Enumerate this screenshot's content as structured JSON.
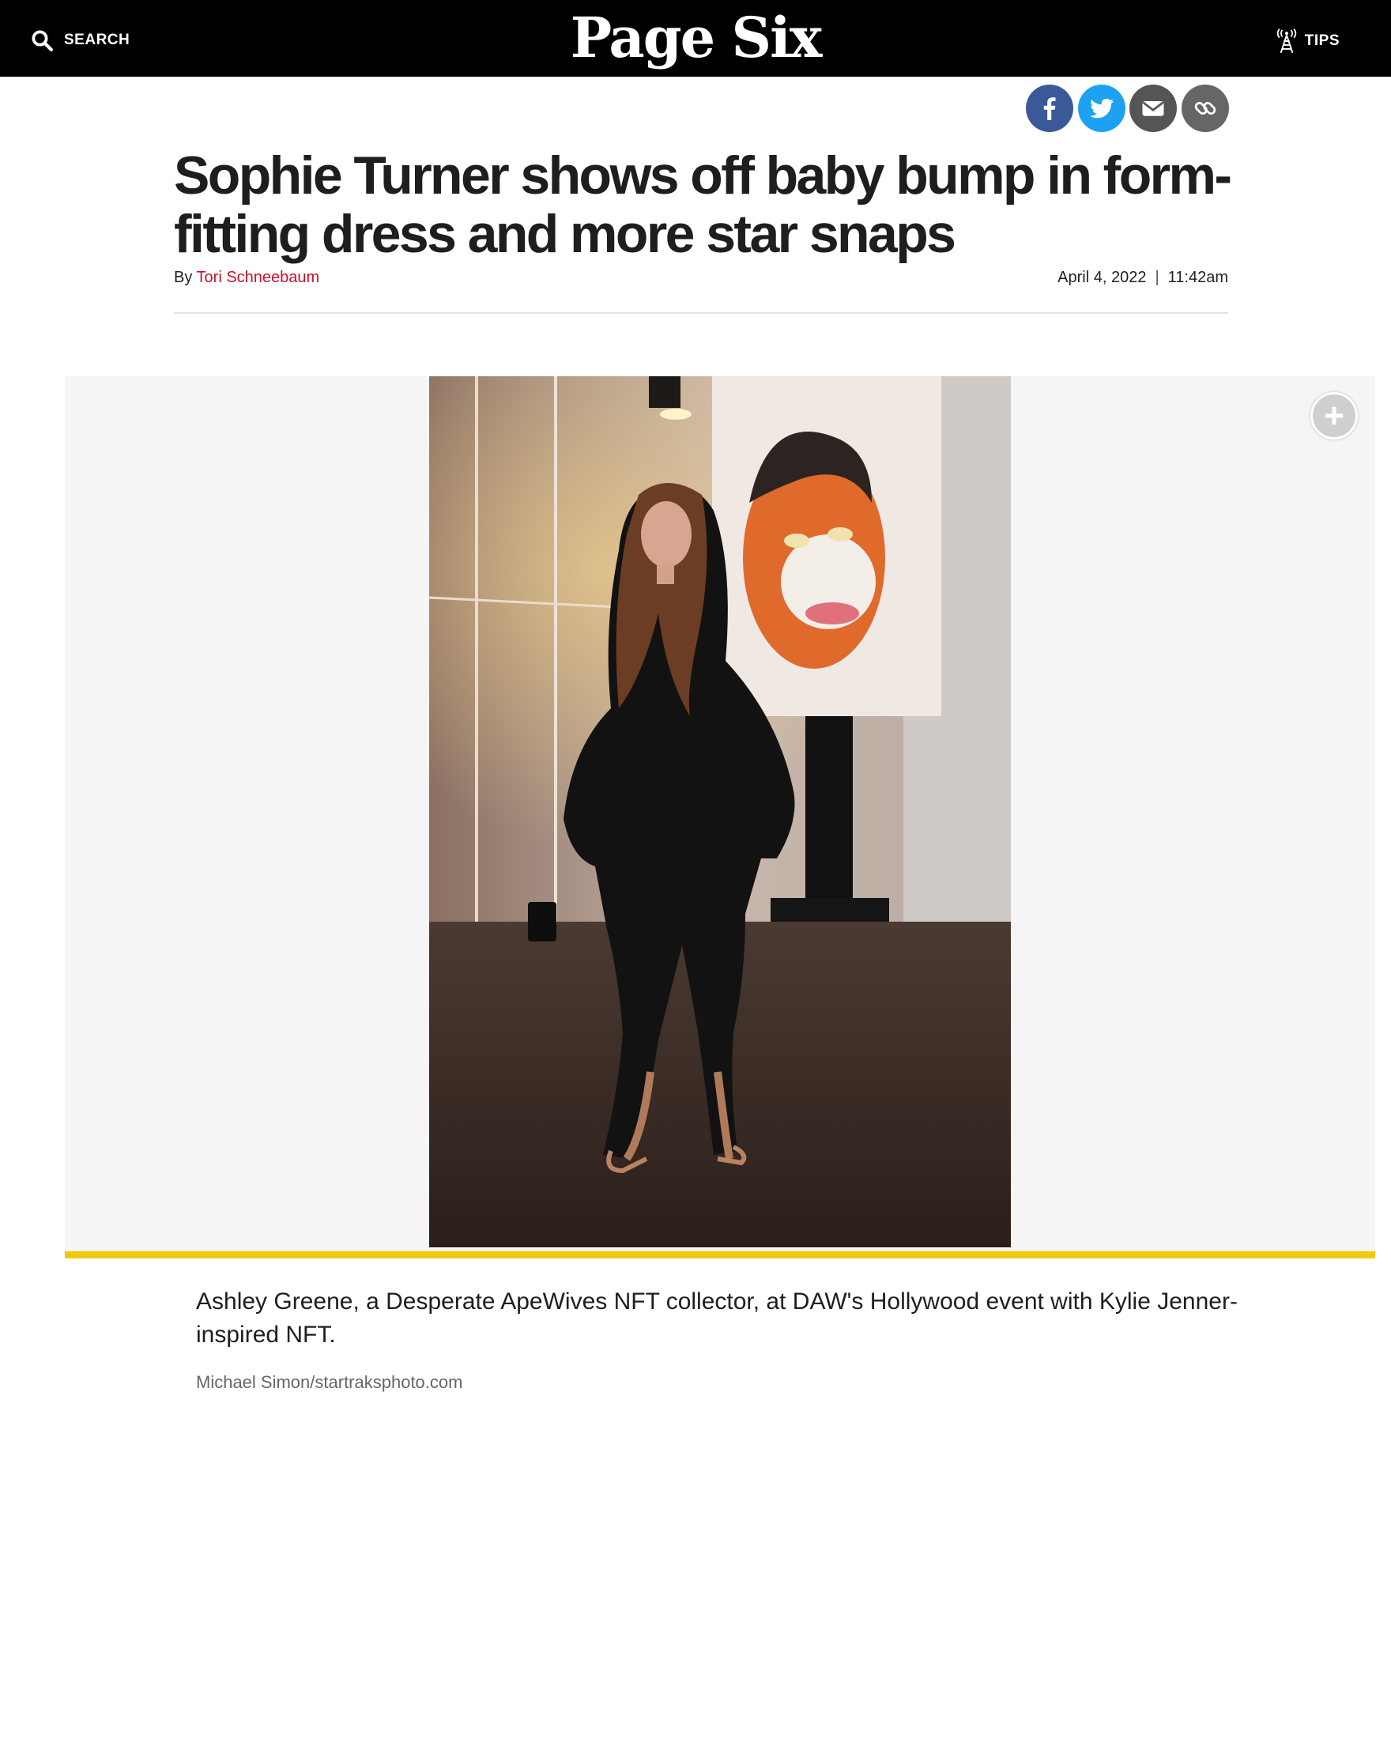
{
  "header": {
    "search_label": "SEARCH",
    "logo": "Page Six",
    "tips_label": "TIPS"
  },
  "share": {
    "icons": [
      "facebook-icon",
      "twitter-icon",
      "email-icon",
      "link-icon"
    ]
  },
  "article": {
    "headline": "Sophie Turner shows off baby bump in form-fitting dress and more star snaps",
    "by": "By",
    "author": "Tori Schneebaum",
    "date": "April 4, 2022",
    "date_separator": "|",
    "time": "11:42am"
  },
  "gallery": {
    "caption": "Ashley Greene, a Desperate ApeWives NFT collector, at DAW's Hollywood event with Kylie Jenner-inspired NFT.",
    "credit": "Michael Simon/startraksphoto.com",
    "expand_icon": "plus-icon"
  },
  "colors": {
    "header_bg": "#000000",
    "author_link": "#c8102e",
    "accent_bar": "#f2c811",
    "facebook": "#3b5998",
    "twitter": "#1da1f2"
  }
}
